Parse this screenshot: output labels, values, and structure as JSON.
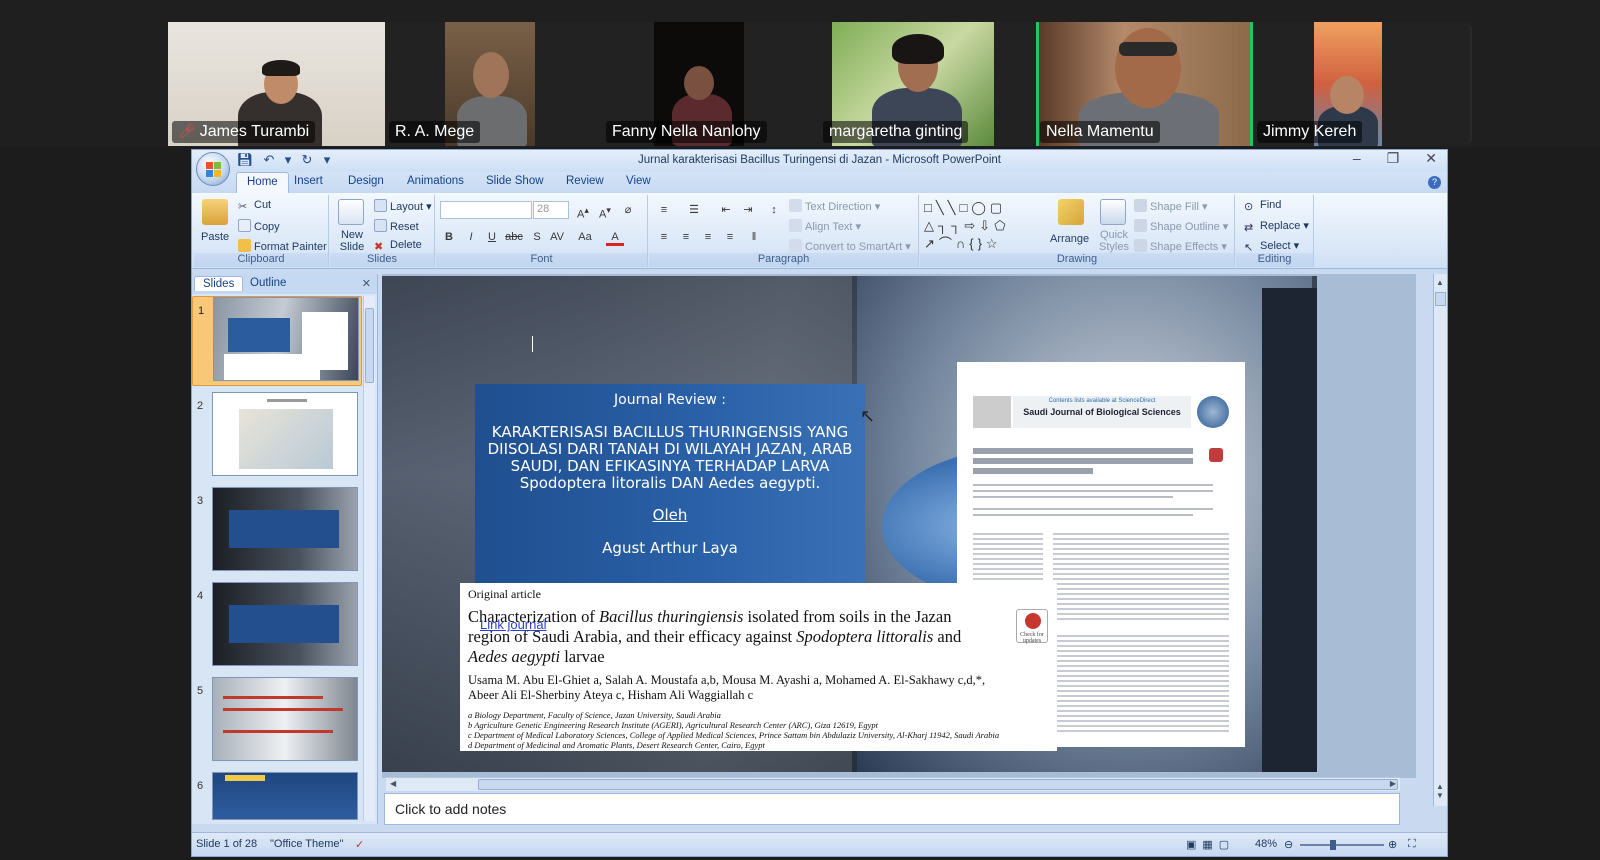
{
  "participants": [
    {
      "name": "James Turambi",
      "muted": true,
      "active": false
    },
    {
      "name": "R. A. Mege",
      "muted": false,
      "active": false
    },
    {
      "name": "Fanny Nella Nanlohy",
      "muted": false,
      "active": false
    },
    {
      "name": "margaretha ginting",
      "muted": false,
      "active": false
    },
    {
      "name": "Nella Mamentu",
      "muted": false,
      "active": true
    },
    {
      "name": "Jimmy Kereh",
      "muted": false,
      "active": false
    }
  ],
  "window": {
    "title": "Jurnal karakterisasi Bacillus Turingensi di Jazan - Microsoft PowerPoint"
  },
  "ribbon_tabs": [
    "Home",
    "Insert",
    "Design",
    "Animations",
    "Slide Show",
    "Review",
    "View"
  ],
  "clipboard": {
    "paste": "Paste",
    "cut": "Cut",
    "copy": "Copy",
    "format_painter": "Format Painter",
    "label": "Clipboard"
  },
  "slides_group": {
    "new_slide": "New Slide",
    "layout": "Layout",
    "reset": "Reset",
    "delete": "Delete",
    "label": "Slides"
  },
  "font_group": {
    "size": "28",
    "label": "Font"
  },
  "paragraph_group": {
    "text_direction": "Text Direction",
    "align_text": "Align Text",
    "convert_smartart": "Convert to SmartArt",
    "label": "Paragraph"
  },
  "drawing_group": {
    "arrange": "Arrange",
    "quick_styles": "Quick Styles",
    "shape_fill": "Shape Fill",
    "shape_outline": "Shape Outline",
    "shape_effects": "Shape Effects",
    "label": "Drawing"
  },
  "editing_group": {
    "find": "Find",
    "replace": "Replace",
    "select": "Select",
    "label": "Editing"
  },
  "panel_tabs": {
    "slides": "Slides",
    "outline": "Outline"
  },
  "thumbnails": [
    {
      "num": "1",
      "selected": true
    },
    {
      "num": "2",
      "selected": false
    },
    {
      "num": "3",
      "selected": false
    },
    {
      "num": "4",
      "selected": false
    },
    {
      "num": "5",
      "selected": false
    },
    {
      "num": "6",
      "selected": false
    }
  ],
  "slide": {
    "heading": "Journal Review :",
    "title_lines": [
      "KARAKTERISASI BACILLUS THURINGENSIS YANG",
      "DIISOLASI DARI TANAH DI WILAYAH JAZAN, ARAB",
      "SAUDI, DAN EFIKASINYA TERHADAP LARVA",
      "Spodoptera litoralis DAN Aedes aegypti."
    ],
    "by": "Oleh",
    "author": "Agust Arthur Laya",
    "paper_type": "Original article",
    "paper_title_1": "Characterization of ",
    "paper_title_italic": "Bacillus thuringiensis",
    "paper_title_2": " isolated from soils in the Jazan",
    "paper_title_3": "region of Saudi Arabia, and their efficacy against ",
    "paper_title_italic_2": "Spodoptera littoralis",
    "paper_title_4": " and",
    "paper_title_italic_3": "Aedes aegypti",
    "paper_title_5": " larvae",
    "link": "Link journal",
    "authors_line_1": "Usama M. Abu El-Ghiet a, Salah A. Moustafa a,b, Mousa M. Ayashi a, Mohamed A. El-Sakhawy c,d,*,",
    "authors_line_2": "Abeer Ali El-Sherbiny Ateya c, Hisham Ali Waggiallah c",
    "affil_a": "a Biology Department, Faculty of Science, Jazan University, Saudi Arabia",
    "affil_b": "b Agriculture Genetic Engineering Research Institute (AGERI), Agricultural Research Center (ARC), Giza 12619, Egypt",
    "affil_c": "c Department of Medical Laboratory Sciences, College of Applied Medical Sciences, Prince Sattam bin Abdulaziz University, Al-Kharj 11942, Saudi Arabia",
    "affil_d": "d Department of Medicinal and Aromatic Plants, Desert Research Center, Cairo, Egypt",
    "journal_name": "Saudi Journal of Biological Sciences",
    "journal_small": "Contents lists available at ScienceDirect",
    "check_updates": "Check for updates"
  },
  "notes_placeholder": "Click to add notes",
  "status": {
    "slide_of": "Slide 1 of 28",
    "theme": "\"Office Theme\"",
    "zoom": "48%"
  }
}
